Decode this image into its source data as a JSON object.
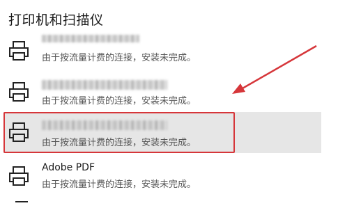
{
  "section": {
    "title": "打印机和扫描仪"
  },
  "printers": [
    {
      "name": "",
      "status": "由于按流量计费的连接，安装未完成。",
      "icon": "printer-icon",
      "name_blurred": true,
      "selected": false
    },
    {
      "name": "",
      "status": "由于按流量计费的连接，安装未完成。",
      "icon": "printer-icon",
      "name_blurred": true,
      "selected": false
    },
    {
      "name": "",
      "status": "由于按流量计费的连接，安装未完成。",
      "icon": "printer-icon",
      "name_blurred": true,
      "selected": true
    },
    {
      "name": "Adobe PDF",
      "status": "由于按流量计费的连接，安装未完成。",
      "icon": "printer-icon",
      "name_blurred": false,
      "selected": false
    }
  ],
  "annotations": {
    "highlight_color": "#d6363a",
    "arrow_color": "#d6363a"
  }
}
